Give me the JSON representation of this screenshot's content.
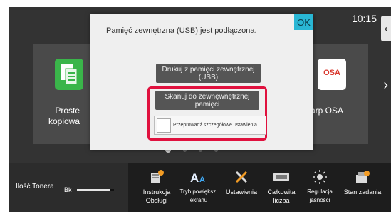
{
  "status": {
    "time": "10:15"
  },
  "home": {
    "left_app_label": "Proste\nkopiowa",
    "right_app_label": "arp OSA",
    "right_app_logo": "OSA",
    "side_tab_glyph": "‹",
    "next_arrow": "›"
  },
  "dialog": {
    "message": "Pamięć zewnętrzna (USB) jest podłączona.",
    "ok_label": "OK",
    "print_button": "Drukuj z pamięci zewnętrznej (USB)",
    "scan_button": "Skanuj do zewnęwnętrznej pamięci",
    "detail_settings": "Przeprowadź szczegółowe ustawienia",
    "detail_checked": false
  },
  "pager": {
    "pages": 4,
    "active": 0
  },
  "taskbar": {
    "toner_title": "Ilość Tonera",
    "toner_color_label": "Bk",
    "toner_level": 0.9,
    "items": [
      {
        "label": "Instrukcja\nObsługi",
        "icon": "manual-icon"
      },
      {
        "label": "Tryb powiększ.\nekranu",
        "icon": "text-zoom-icon"
      },
      {
        "label": "Ustawienia",
        "icon": "settings-tools-icon"
      },
      {
        "label": "Całkowita\nliczba",
        "icon": "counter-icon"
      },
      {
        "label": "Regulacja\njasności",
        "icon": "brightness-icon"
      },
      {
        "label": "Stan zadania",
        "icon": "job-status-icon"
      }
    ]
  },
  "colors": {
    "highlight": "#e0113e",
    "ok": "#29b6d4",
    "app_green": "#3ab54a"
  }
}
